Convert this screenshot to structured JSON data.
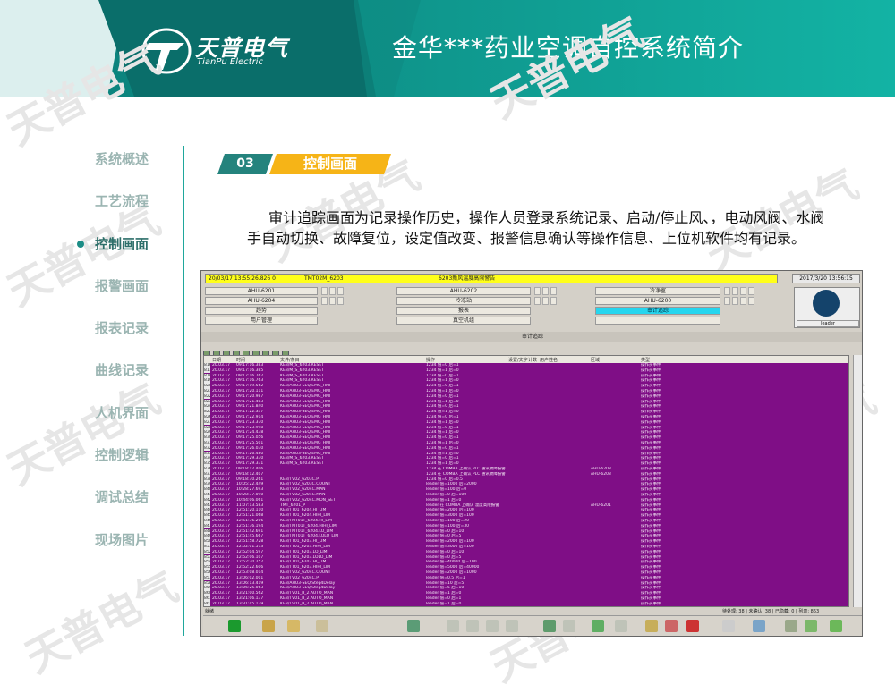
{
  "slide_title": "金华***药业空调自控系统简介",
  "logo": {
    "brand_cn": "天普电气",
    "brand_en": "TianPu Electric"
  },
  "watermark": "天普电气",
  "nav": {
    "items": [
      {
        "label": "系统概述",
        "active": false
      },
      {
        "label": "工艺流程",
        "active": false
      },
      {
        "label": "控制画面",
        "active": true
      },
      {
        "label": "报警画面",
        "active": false
      },
      {
        "label": "报表记录",
        "active": false
      },
      {
        "label": "曲线记录",
        "active": false
      },
      {
        "label": "人机界面",
        "active": false
      },
      {
        "label": "控制逻辑",
        "active": false
      },
      {
        "label": "调试总结",
        "active": false
      },
      {
        "label": "现场图片",
        "active": false
      }
    ]
  },
  "section": {
    "number": "03",
    "label": "控制画面"
  },
  "description": "审计追踪画面为记录操作历史，操作人员登录系统记录、启动/停止风、，电动风阀、水阀手自动切换、故障复位，设定值改变、报警信息确认等操作信息、上位机软件均有记录。",
  "screen": {
    "alarm_time": "20/03/17 13:55:26.826 0",
    "alarm_tag": "TMT02M_6203",
    "alarm_text": "6203新风温度高限警告",
    "clock": "2017/3/20 13:56:15",
    "nav_buttons": [
      [
        "AHU-6201",
        "AHU-6202",
        "冷净室"
      ],
      [
        "AHU-6204",
        "冷冻站",
        "AHU-6200"
      ],
      [
        "趋势",
        "报表",
        "审计追踪"
      ],
      [
        "用户管理",
        "真空机组",
        ""
      ]
    ],
    "highlight_button": "审计追踪",
    "crest_caption": "leader",
    "panel_title": "审计追踪",
    "columns": [
      "日期",
      "时间",
      "文件/条目",
      "操作",
      "设置/文字",
      "计数",
      "用户姓名",
      "区域",
      "类型"
    ],
    "rows": [
      {
        "n": "816",
        "d": "20.03.17",
        "t": "09:17:16.383",
        "item": "KEB/M_S_6203.RESET",
        "op": "1234 值=0 后=1",
        "area": "",
        "type": "操作员事件"
      },
      {
        "n": "817",
        "d": "20.03.17",
        "t": "09:17:16.385",
        "item": "KEB/M_S_6203.RESET",
        "op": "1234 值=1 后=0",
        "area": "",
        "type": "操作员事件"
      },
      {
        "n": "818",
        "d": "20.03.17",
        "t": "09:17:16.762",
        "item": "KEB/M_S_6203.RESET",
        "op": "1234 值=0 后=1",
        "area": "",
        "type": "操作员事件"
      },
      {
        "n": "819",
        "d": "20.03.17",
        "t": "09:17:16.763",
        "item": "KEB/M_S_6203.RESET",
        "op": "1234 值=1 后=0",
        "area": "",
        "type": "操作员事件"
      },
      {
        "n": "820",
        "d": "20.03.17",
        "t": "09:17:19.562",
        "item": "KEB/AHU3-SEQ.EMG_HMI",
        "op": "1234 值=0 后=1",
        "area": "",
        "type": "操作员事件"
      },
      {
        "n": "821",
        "d": "20.03.17",
        "t": "09:17:20.111",
        "item": "KEB/AHU3-SEQ.EMG_HMI",
        "op": "1234 值=1 后=0",
        "area": "",
        "type": "操作员事件"
      },
      {
        "n": "822",
        "d": "20.03.17",
        "t": "09:17:20.987",
        "item": "KEB/AHU3-SEQ.EMG_HMI",
        "op": "1234 值=0 后=1",
        "area": "",
        "type": "操作员事件"
      },
      {
        "n": "823",
        "d": "20.03.17",
        "t": "09:17:21.403",
        "item": "KEB/AHU3-SEQ.EMG_HMI",
        "op": "1234 值=1 后=0",
        "area": "",
        "type": "操作员事件"
      },
      {
        "n": "824",
        "d": "20.03.17",
        "t": "09:17:21.840",
        "item": "KEB/AHU3-SEQ.EMG_HMI",
        "op": "1234 值=0 后=1",
        "area": "",
        "type": "操作员事件"
      },
      {
        "n": "825",
        "d": "20.03.17",
        "t": "09:17:22.337",
        "item": "KEB/AHU3-SEQ.EMG_HMI",
        "op": "1234 值=1 后=0",
        "area": "",
        "type": "操作员事件"
      },
      {
        "n": "826",
        "d": "20.03.17",
        "t": "09:17:22.914",
        "item": "KEB/AHU3-SEQ.EMG_HMI",
        "op": "1234 值=0 后=1",
        "area": "",
        "type": "操作员事件"
      },
      {
        "n": "827",
        "d": "20.03.17",
        "t": "09:17:23.370",
        "item": "KEB/AHU3-SEQ.EMG_HMI",
        "op": "1234 值=1 后=0",
        "area": "",
        "type": "操作员事件"
      },
      {
        "n": "828",
        "d": "20.03.17",
        "t": "09:17:23.998",
        "item": "KEB/AHU3-SEQ.EMG_HMI",
        "op": "1234 值=0 后=1",
        "area": "",
        "type": "操作员事件"
      },
      {
        "n": "829",
        "d": "20.03.17",
        "t": "09:17:24.438",
        "item": "KEB/AHU3-SEQ.EMG_HMI",
        "op": "1234 值=1 后=0",
        "area": "",
        "type": "操作员事件"
      },
      {
        "n": "830",
        "d": "20.03.17",
        "t": "09:17:25.056",
        "item": "KEB/AHU3-SEQ.EMG_HMI",
        "op": "1234 值=0 后=1",
        "area": "",
        "type": "操作员事件"
      },
      {
        "n": "831",
        "d": "20.03.17",
        "t": "09:17:25.501",
        "item": "KEB/AHU3-SEQ.EMG_HMI",
        "op": "1234 值=1 后=0",
        "area": "",
        "type": "操作员事件"
      },
      {
        "n": "832",
        "d": "20.03.17",
        "t": "09:17:26.030",
        "item": "KEB/AHU3-SEQ.EMG_HMI",
        "op": "1234 值=0 后=1",
        "area": "",
        "type": "操作员事件"
      },
      {
        "n": "833",
        "d": "20.03.17",
        "t": "09:17:26.480",
        "item": "KEB/AHU3-SEQ.EMG_HMI",
        "op": "1234 值=1 后=0",
        "area": "",
        "type": "操作员事件"
      },
      {
        "n": "834",
        "d": "20.03.17",
        "t": "09:17:29.330",
        "item": "KEB/M_S_6203.RESET",
        "op": "1234 值=0 后=1",
        "area": "",
        "type": "操作员事件"
      },
      {
        "n": "835",
        "d": "20.03.17",
        "t": "09:17:29.331",
        "item": "KEB/M_S_6203.RESET",
        "op": "1234 值=1 后=0",
        "area": "",
        "type": "操作员事件"
      },
      {
        "n": "836",
        "d": "20.03.17",
        "t": "09:18:12.406",
        "item": "",
        "op": "1234 在 COMBA 上确认 PLC 通讯故障报警",
        "area": "AHU-6203",
        "type": "操作员事件"
      },
      {
        "n": "837",
        "d": "20.03.17",
        "t": "09:18:12.407",
        "item": "",
        "op": "1234 在 COMBA 上确认 PLC 通讯故障报警",
        "area": "AHU-6203",
        "type": "操作员事件"
      },
      {
        "n": "838",
        "d": "20.03.17",
        "t": "09:18:30.261",
        "item": "KEB/TV02_6203C.P",
        "op": "1234 值=0 后=0.5",
        "area": "",
        "type": "操作员事件"
      },
      {
        "n": "839",
        "d": "20.03.17",
        "t": "10:05:22.449",
        "item": "KEB/TV02_6203C.COUNT",
        "op": "leader 值=1000 后=2000",
        "area": "",
        "type": "操作员事件"
      },
      {
        "n": "840",
        "d": "20.03.17",
        "t": "10:28:27.693",
        "item": "KEB/TV02_6204C.MAN",
        "op": "leader 值=100 后=0",
        "area": "",
        "type": "操作员事件"
      },
      {
        "n": "841",
        "d": "20.03.17",
        "t": "10:28:37.090",
        "item": "KEB/TV02_6204C.MAN",
        "op": "leader 值=0 后=100",
        "area": "",
        "type": "操作员事件"
      },
      {
        "n": "842",
        "d": "20.03.17",
        "t": "10:44:06.061",
        "item": "KEB/TV02_6204C.MON_SET",
        "op": "leader 值=1 后=0",
        "area": "",
        "type": "操作员事件"
      },
      {
        "n": "843",
        "d": "20.03.17",
        "t": "11:07:13.583",
        "item": "TMT_6201_P",
        "op": "leader 在 COMBA 上确认 温度高限报警",
        "area": "AHU-6201",
        "type": "操作员事件"
      },
      {
        "n": "844",
        "d": "20.03.17",
        "t": "12:51:20.110",
        "item": "KEB/TT01_6204.HI_LIM",
        "op": "leader 值=2000 后=100",
        "area": "",
        "type": "操作员事件"
      },
      {
        "n": "845",
        "d": "20.03.17",
        "t": "12:51:21.068",
        "item": "KEB/TT01_6204.HIHI_LIM",
        "op": "leader 值=3000 后=100",
        "area": "",
        "type": "操作员事件"
      },
      {
        "n": "846",
        "d": "20.03.17",
        "t": "12:51:36.206",
        "item": "KEB/TMT01T_6204.HI_LIM",
        "op": "leader 值=100 后=20",
        "area": "",
        "type": "操作员事件"
      },
      {
        "n": "847",
        "d": "20.03.17",
        "t": "12:51:36.194",
        "item": "KEB/TMT01T_6204.HIHI_LIM",
        "op": "leader 值=100 后=30",
        "area": "",
        "type": "操作员事件"
      },
      {
        "n": "848",
        "d": "20.03.17",
        "t": "12:51:42.691",
        "item": "KEB/TMT01T_6204.LO_LIM",
        "op": "leader 值=0 后=10",
        "area": "",
        "type": "操作员事件"
      },
      {
        "n": "849",
        "d": "20.03.17",
        "t": "12:51:45.667",
        "item": "KEB/TMT01T_6204.LOLO_LIM",
        "op": "leader 值=0 后=5",
        "area": "",
        "type": "操作员事件"
      },
      {
        "n": "850",
        "d": "20.03.17",
        "t": "12:51:58.728",
        "item": "KEB/TT01_6203.HI_LIM",
        "op": "leader 值=2000 后=100",
        "area": "",
        "type": "操作员事件"
      },
      {
        "n": "851",
        "d": "20.03.17",
        "t": "12:52:01.573",
        "item": "KEB/TT01_6203.HIHI_LIM",
        "op": "leader 值=3000 后=100",
        "area": "",
        "type": "操作员事件"
      },
      {
        "n": "852",
        "d": "20.03.17",
        "t": "12:52:04.597",
        "item": "KEB/TT01_6203.LO_LIM",
        "op": "leader 值=0 后=10",
        "area": "",
        "type": "操作员事件"
      },
      {
        "n": "853",
        "d": "20.03.17",
        "t": "12:52:06.107",
        "item": "KEB/TT01_6203.LOLO_LIM",
        "op": "leader 值=0 后=5",
        "area": "",
        "type": "操作员事件"
      },
      {
        "n": "854",
        "d": "20.03.17",
        "t": "12:52:20.252",
        "item": "KEB/TT01_6203.HI_LIM",
        "op": "leader 值=40000 后=100",
        "area": "",
        "type": "操作员事件"
      },
      {
        "n": "855",
        "d": "20.03.17",
        "t": "12:52:22.606",
        "item": "KEB/TT01_6203.HIHI_LIM",
        "op": "leader 值=5000 后=40000",
        "area": "",
        "type": "操作员事件"
      },
      {
        "n": "856",
        "d": "20.03.17",
        "t": "12:53:08.014",
        "item": "KEB/TV02_6204C.COUNT",
        "op": "leader 值=2000 后=1000",
        "area": "",
        "type": "操作员事件"
      },
      {
        "n": "857",
        "d": "20.03.17",
        "t": "13:06:02.001",
        "item": "KEB/TV02_6204C.P",
        "op": "leader 值=0.5 后=1",
        "area": "",
        "type": "操作员事件"
      },
      {
        "n": "858",
        "d": "20.03.17",
        "t": "13:06:13.419",
        "item": "KEB/AHU3-SEQ.Step4Delay",
        "op": "leader 值=10 后=5",
        "area": "",
        "type": "操作员事件"
      },
      {
        "n": "859",
        "d": "20.03.17",
        "t": "13:06:25.063",
        "item": "KEB/AHU3-SEQ.Step4Delay",
        "op": "leader 值=5 后=10",
        "area": "",
        "type": "操作员事件"
      },
      {
        "n": "860",
        "d": "20.03.17",
        "t": "13:21:00.562",
        "item": "KEB/TV01_B_2.AUTO_MAN",
        "op": "leader 值=1 后=0",
        "area": "",
        "type": "操作员事件"
      },
      {
        "n": "861",
        "d": "20.03.17",
        "t": "13:21:06.137",
        "item": "KEB/TV01_B_2.AUTO_MAN",
        "op": "leader 值=0 后=1",
        "area": "",
        "type": "操作员事件"
      },
      {
        "n": "862",
        "d": "20.03.17",
        "t": "13:31:45.139",
        "item": "KEB/TV01_B_2.AUTO_MAN",
        "op": "leader 值=1 后=0",
        "area": "",
        "type": "操作员事件"
      },
      {
        "n": "863",
        "d": "20.03.17",
        "t": "13:41:51.873",
        "item": "KEB/TV02_6204C.MAN",
        "op": "leader 值=0 后=14.8153",
        "area": "",
        "type": "操作员事件"
      },
      {
        "n": "864",
        "d": "20.03.17",
        "t": "13:43:51.873",
        "item": "KEB/TV02_6204C.MAN",
        "op": "leader 值=0 后=15.9753",
        "area": "",
        "type": "操作员事件"
      }
    ],
    "status_left": "就绪",
    "status_right": "待处理: 38  |  未确认: 38  |  已隐藏: 0  |  列表: 863"
  },
  "colors": {
    "teal": "#0d8f87",
    "accent": "#f6b417",
    "row_bg": "#7f0e86",
    "highlight": "#26d6ee"
  }
}
